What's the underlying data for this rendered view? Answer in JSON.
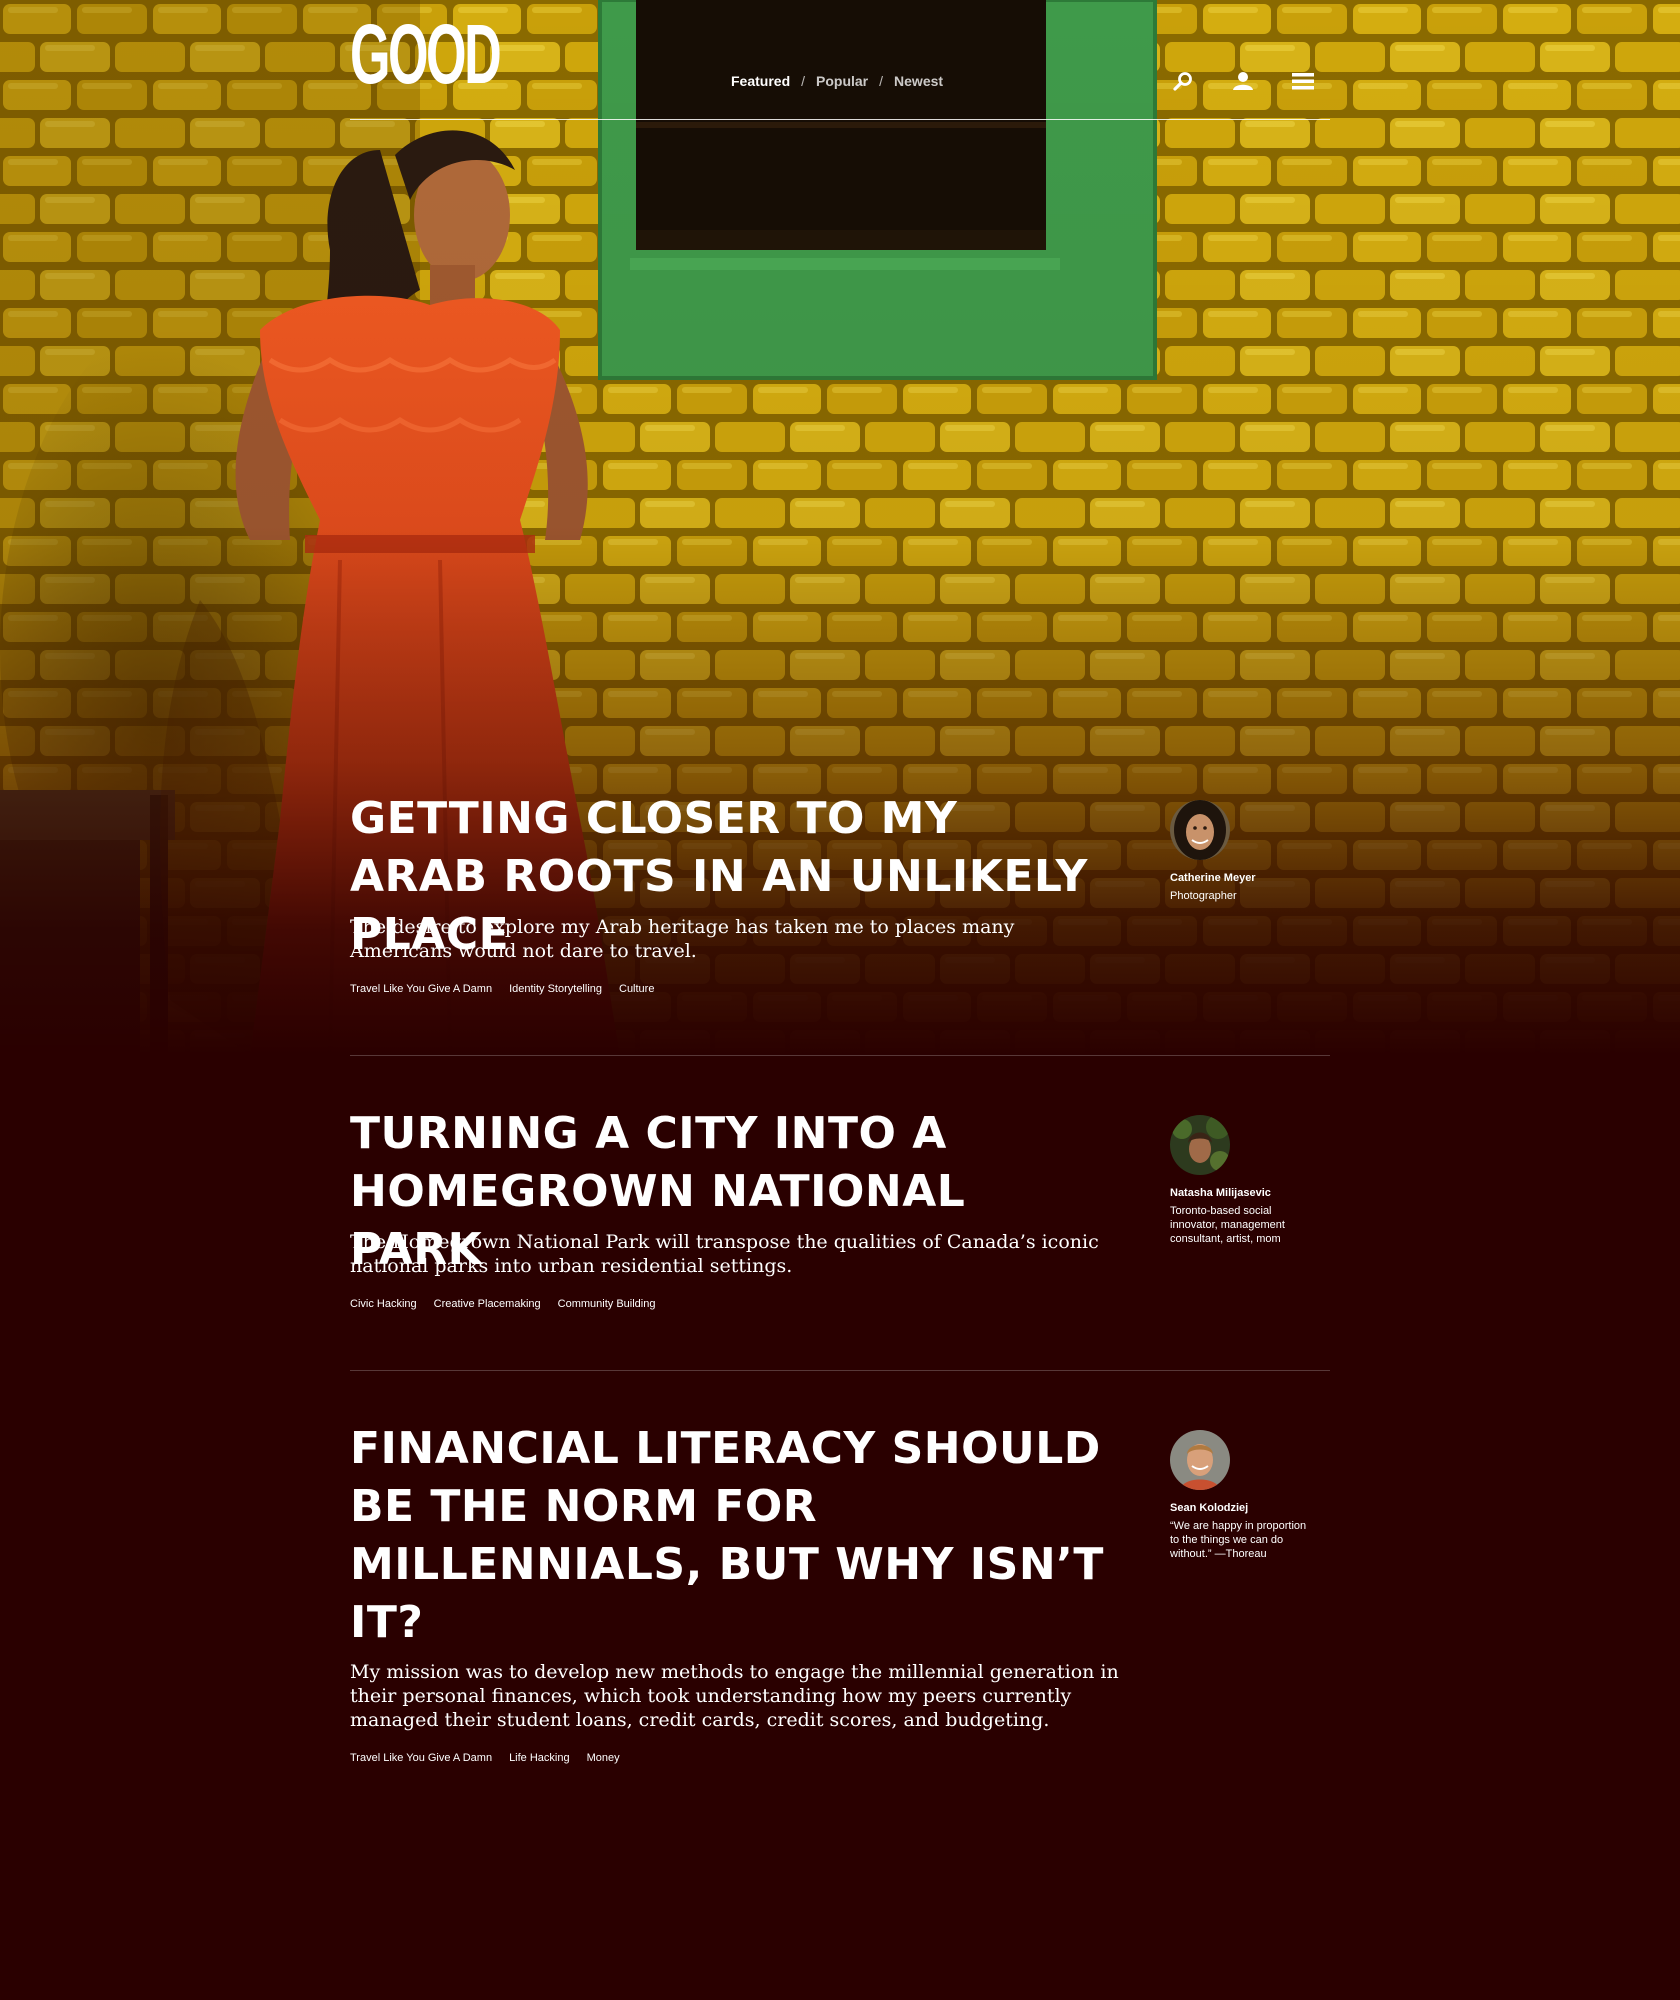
{
  "header": {
    "logo": "GOOD",
    "nav": {
      "featured": "Featured",
      "popular": "Popular",
      "newest": "Newest",
      "separator": "/"
    },
    "icons": [
      "search-icon",
      "user-icon",
      "menu-icon"
    ]
  },
  "articles": [
    {
      "title": "Getting Closer to My Arab Roots in an Unlikely Place",
      "summary": "The desire to explore my Arab heritage has taken me to places many Americans would not dare to travel.",
      "tags": [
        "Travel Like You Give A Damn",
        "Identity Storytelling",
        "Culture"
      ],
      "author": {
        "name": "Catherine Meyer",
        "bio": "Photographer"
      }
    },
    {
      "title": "Turning a City Into a Homegrown National Park",
      "summary": "The Homegrown National Park will transpose the qualities of Canada’s iconic national parks into urban residential settings.",
      "tags": [
        "Civic Hacking",
        "Creative Placemaking",
        "Community Building"
      ],
      "author": {
        "name": "Natasha Milijasevic",
        "bio": "Toronto-based social innovator, management consultant, artist, mom"
      }
    },
    {
      "title": "Financial Literacy Should Be the Norm for Millennials, But Why Isn’t It?",
      "summary": "My mission was to develop new methods to engage the millennial generation in their personal finances, which took understanding how my peers currently managed their student loans, credit cards, credit scores, and budgeting.",
      "tags": [
        "Travel Like You Give A Damn",
        "Life Hacking",
        "Money"
      ],
      "author": {
        "name": "Sean Kolodziej",
        "bio": "“We are happy in proportion to the things we can do without.” —Thoreau"
      }
    }
  ],
  "colors": {
    "background": "#2a0000",
    "brick_yellow": "#c9a000",
    "window_green": "#3f9a4a",
    "dress_red": "#e04a1a",
    "text": "#ffffff"
  }
}
